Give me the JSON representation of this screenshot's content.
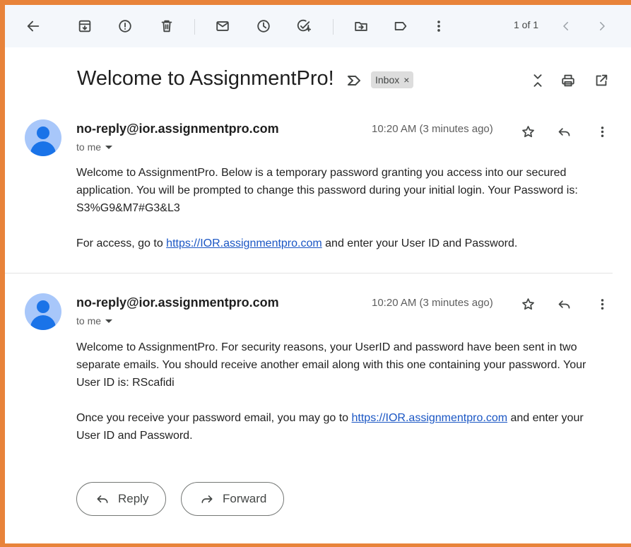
{
  "toolbar": {
    "back_icon": "arrow-left-icon",
    "archive_icon": "archive-icon",
    "report_spam_icon": "report-spam-icon",
    "delete_icon": "trash-icon",
    "mark_unread_icon": "mail-icon",
    "snooze_icon": "clock-icon",
    "add_task_icon": "add-task-icon",
    "move_to_icon": "move-to-folder-icon",
    "label_icon": "label-icon",
    "more_icon": "more-vert-icon",
    "page_count": "1 of 1"
  },
  "thread": {
    "subject": "Welcome to AssignmentPro!",
    "label": "Inbox",
    "label_remove": "×"
  },
  "messages": [
    {
      "sender": "no-reply@ior.assignmentpro.com",
      "recipient": "to me",
      "time": "10:20 AM (3 minutes ago)",
      "paragraphs": [
        {
          "text": "Welcome to AssignmentPro. Below is a temporary password granting you access into our secured application. You will be prompted to change this password during your initial login. Your Password is: S3%G9&M7#G3&L3"
        },
        {
          "before": "For access, go to ",
          "link": "https://IOR.assignmentpro.com",
          "after": " and enter your User ID and Password."
        }
      ]
    },
    {
      "sender": "no-reply@ior.assignmentpro.com",
      "recipient": "to me",
      "time": "10:20 AM (3 minutes ago)",
      "paragraphs": [
        {
          "text": "Welcome to AssignmentPro. For security reasons, your UserID and password have been sent in two separate emails. You should receive another email along with this one containing your password. Your User ID is: RScafidi"
        },
        {
          "before": "Once you receive your password email, you may go to ",
          "link": "https://IOR.assignmentpro.com",
          "after": " and enter your User ID and Password."
        }
      ]
    }
  ],
  "actions": {
    "reply_label": "Reply",
    "forward_label": "Forward"
  },
  "colors": {
    "frame_border": "#e8833a",
    "toolbar_bg": "#f4f7fb",
    "avatar_bg": "#a8c7fa",
    "avatar_fg": "#1a73e8",
    "link": "#1a56c4"
  }
}
